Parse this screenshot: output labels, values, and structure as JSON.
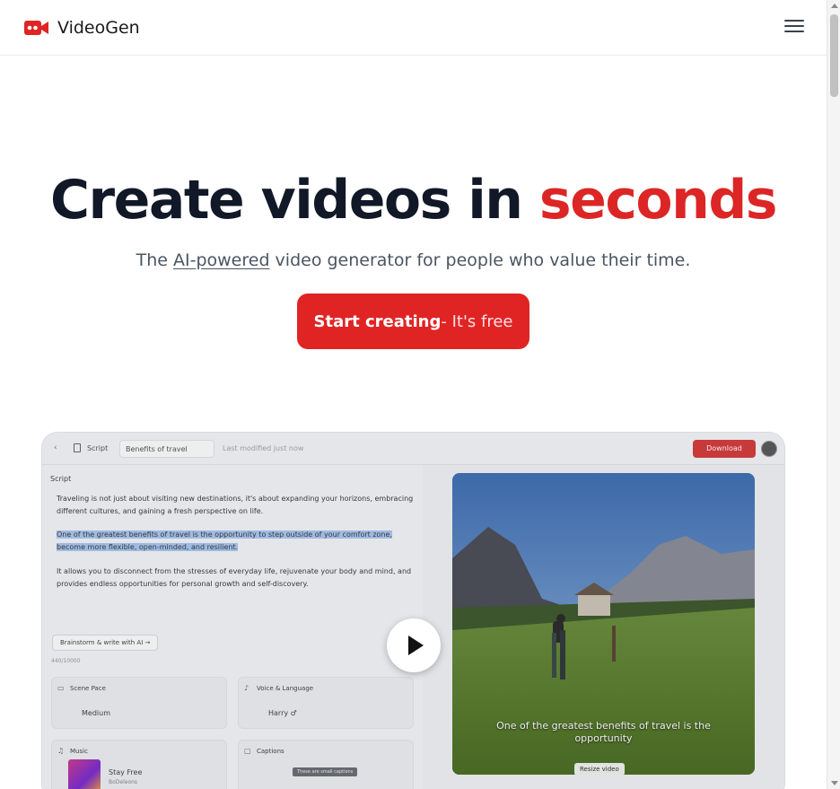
{
  "header": {
    "brand": "VideoGen",
    "logo_icon": "video-camera-icon",
    "menu_icon": "hamburger-menu-icon"
  },
  "hero": {
    "title_main": "Create videos in ",
    "title_accent": "seconds",
    "subtitle_before": "The ",
    "subtitle_link": "AI-powered",
    "subtitle_after": " video generator for people who value their time.",
    "cta_strong": "Start creating",
    "cta_light": " - It's free"
  },
  "preview": {
    "topbar": {
      "back": "‹",
      "tab_label": "Script",
      "doc_title": "Benefits of travel",
      "modified": "Last modified just now",
      "download": "Download"
    },
    "script": {
      "label": "Script",
      "para1": "Traveling is not just about visiting new destinations, it's about expanding your horizons, embracing different cultures, and gaining a fresh perspective on life.",
      "para2": "One of the greatest benefits of travel is the opportunity to step outside of your comfort zone, become more flexible, open-minded, and resilient.",
      "para3": "It allows you to disconnect from the stresses of everyday life, rejuvenate your body and mind, and provides endless opportunities for personal growth and self-discovery.",
      "brainstorm": "Brainstorm & write with AI  →",
      "char_count": "440/10000"
    },
    "cards": {
      "scene_pace_title": "Scene Pace",
      "scene_pace_value": "Medium",
      "voice_title": "Voice & Language",
      "voice_value": "Harry ♂",
      "music_title": "Music",
      "music_track": "Stay Free",
      "music_artist": "BoDeleons",
      "captions_title": "Captions",
      "captions_chip": "These are small captions"
    },
    "video": {
      "caption": "One of the greatest benefits of travel is the opportunity",
      "resize": "Resize video"
    },
    "accent_color": "#dc2626"
  }
}
